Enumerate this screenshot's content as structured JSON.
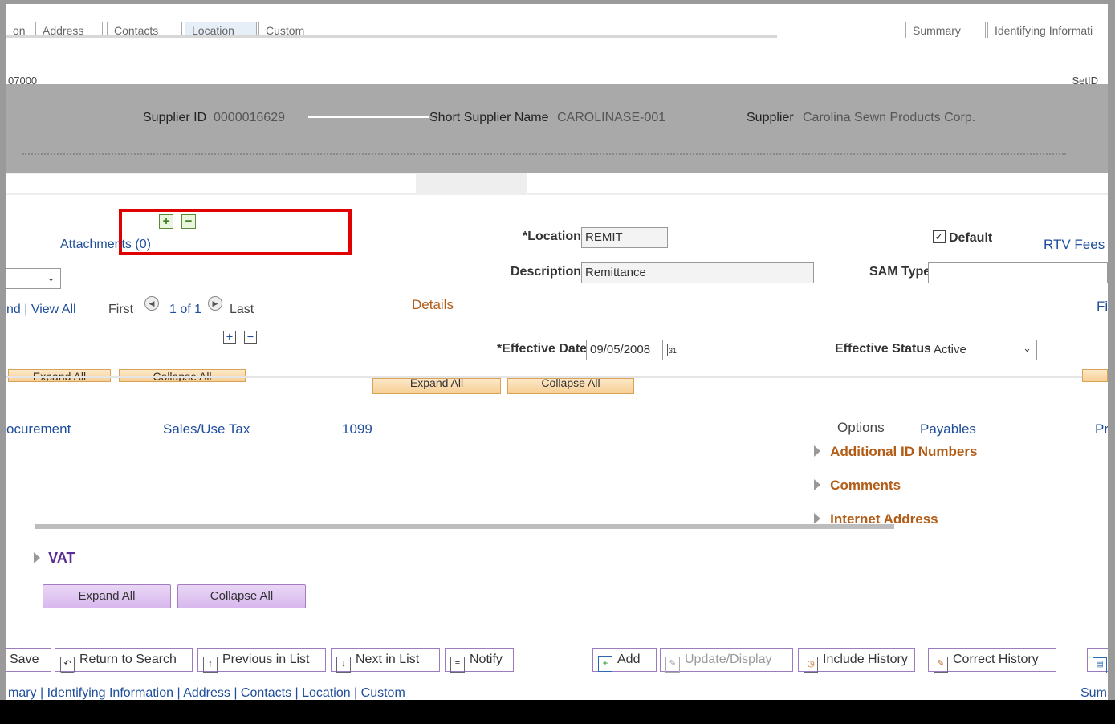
{
  "tabs_top": {
    "left": [
      "on",
      "Address",
      "Contacts",
      "Location",
      "Custom"
    ],
    "right": [
      "Summary",
      "Identifying Informati"
    ]
  },
  "supplier": {
    "setid_prefix": "07000",
    "setid_label": "SetID",
    "supplier_id_label": "Supplier ID",
    "supplier_id_value": "0000016629",
    "short_name_label": "Short Supplier Name",
    "short_name_value": "CAROLINASE-001",
    "supplier_label": "Supplier",
    "supplier_value": "Carolina Sewn Products Corp."
  },
  "left_panel": {
    "attachments_label": "Attachments (0)",
    "find_view_all": "nd | View All",
    "first": "First",
    "pager": "1 of 1",
    "last": "Last",
    "plus": "+",
    "minus": "−"
  },
  "location": {
    "location_label": "*Location",
    "location_value": "REMIT",
    "default_label": "Default",
    "default_checked": true,
    "rtv_fees": "RTV Fees",
    "description_label": "Description",
    "description_value": "Remittance",
    "sam_type_label": "SAM Type",
    "sam_type_value": "",
    "details_label": "Details",
    "fi_label": "Fi",
    "effective_date_label": "*Effective Date",
    "effective_date_value": "09/05/2008",
    "effective_status_label": "Effective Status",
    "effective_status_value": "Active"
  },
  "expand_small": {
    "expand": "Expand All",
    "collapse": "Collapse All"
  },
  "sub_links": {
    "procurement": "ocurement",
    "sales_use_tax": "Sales/Use Tax",
    "form_1099": "1099",
    "options": "Options",
    "payables": "Payables",
    "pr": "Pr"
  },
  "sections": {
    "additional_id": "Additional ID Numbers",
    "comments": "Comments",
    "internet": "Internet Address",
    "vat": "VAT"
  },
  "expand_buttons": {
    "expand": "Expand All",
    "collapse": "Collapse All"
  },
  "toolbar": {
    "save": "Save",
    "return_to_search": "Return to Search",
    "previous_in_list": "Previous in List",
    "next_in_list": "Next in List",
    "notify": "Notify",
    "add": "Add",
    "update_display": "Update/Display",
    "include_history": "Include History",
    "correct_history": "Correct History"
  },
  "footer_links": {
    "left": "mary | Identifying Information | Address | Contacts | Location | Custom",
    "right": "Sum"
  },
  "colors": {
    "link": "#1f4e9c",
    "section": "#b25c16",
    "purple_button": "#d8b8ee",
    "highlight_box": "#e00000",
    "vat": "#5a2d91"
  }
}
